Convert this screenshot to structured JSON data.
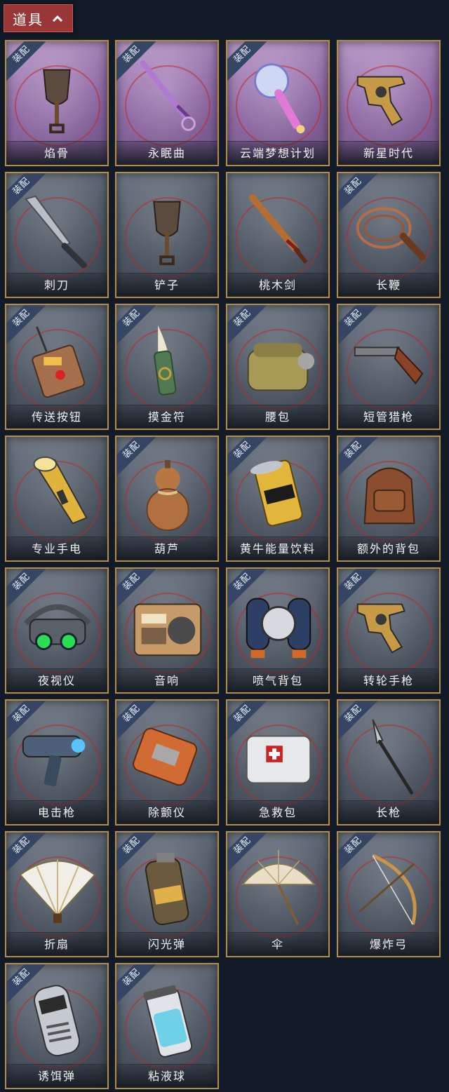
{
  "section": {
    "title": "道具",
    "collapse_icon": "chevron-up-icon"
  },
  "colors": {
    "background": "#121a27",
    "tab": "#9b3636",
    "card_border": "#b18c4a",
    "ribbon": "#354563",
    "ring": "#be2828"
  },
  "equip_label": "装配",
  "items": [
    {
      "name": "焰骨",
      "icon": "shovel-icon",
      "equipped": true,
      "rarity": "purple"
    },
    {
      "name": "永眠曲",
      "icon": "sword-icon",
      "equipped": true,
      "rarity": "purple"
    },
    {
      "name": "云端梦想计划",
      "icon": "mace-icon",
      "equipped": true,
      "rarity": "purple"
    },
    {
      "name": "新星时代",
      "icon": "revolver-icon",
      "equipped": false,
      "rarity": "purple"
    },
    {
      "name": "刺刀",
      "icon": "bayonet-icon",
      "equipped": true,
      "rarity": "gray"
    },
    {
      "name": "铲子",
      "icon": "shovel-icon",
      "equipped": false,
      "rarity": "gray"
    },
    {
      "name": "桃木剑",
      "icon": "wooden-sword-icon",
      "equipped": false,
      "rarity": "gray"
    },
    {
      "name": "长鞭",
      "icon": "whip-icon",
      "equipped": true,
      "rarity": "gray"
    },
    {
      "name": "传送按钮",
      "icon": "remote-icon",
      "equipped": true,
      "rarity": "gray"
    },
    {
      "name": "摸金符",
      "icon": "talisman-icon",
      "equipped": true,
      "rarity": "gray"
    },
    {
      "name": "腰包",
      "icon": "waist-bag-icon",
      "equipped": true,
      "rarity": "gray"
    },
    {
      "name": "短管猎枪",
      "icon": "shotgun-icon",
      "equipped": true,
      "rarity": "gray"
    },
    {
      "name": "专业手电",
      "icon": "flashlight-icon",
      "equipped": false,
      "rarity": "gray"
    },
    {
      "name": "葫芦",
      "icon": "gourd-icon",
      "equipped": true,
      "rarity": "gray"
    },
    {
      "name": "黄牛能量饮料",
      "icon": "can-icon",
      "equipped": true,
      "rarity": "gray"
    },
    {
      "name": "额外的背包",
      "icon": "backpack-icon",
      "equipped": true,
      "rarity": "gray"
    },
    {
      "name": "夜视仪",
      "icon": "goggles-icon",
      "equipped": true,
      "rarity": "gray"
    },
    {
      "name": "音响",
      "icon": "radio-icon",
      "equipped": true,
      "rarity": "gray"
    },
    {
      "name": "喷气背包",
      "icon": "jetpack-icon",
      "equipped": true,
      "rarity": "gray"
    },
    {
      "name": "转轮手枪",
      "icon": "revolver-icon",
      "equipped": true,
      "rarity": "gray"
    },
    {
      "name": "电击枪",
      "icon": "shock-gun-icon",
      "equipped": true,
      "rarity": "gray"
    },
    {
      "name": "除颤仪",
      "icon": "defibrillator-icon",
      "equipped": true,
      "rarity": "gray"
    },
    {
      "name": "急救包",
      "icon": "first-aid-icon",
      "equipped": true,
      "rarity": "gray"
    },
    {
      "name": "长枪",
      "icon": "spear-icon",
      "equipped": true,
      "rarity": "gray"
    },
    {
      "name": "折扇",
      "icon": "fan-icon",
      "equipped": true,
      "rarity": "gray"
    },
    {
      "name": "闪光弹",
      "icon": "grenade-icon",
      "equipped": true,
      "rarity": "gray"
    },
    {
      "name": "伞",
      "icon": "umbrella-icon",
      "equipped": true,
      "rarity": "gray"
    },
    {
      "name": "爆炸弓",
      "icon": "bow-icon",
      "equipped": true,
      "rarity": "gray"
    },
    {
      "name": "诱饵弹",
      "icon": "canister-icon",
      "equipped": true,
      "rarity": "gray"
    },
    {
      "name": "粘液球",
      "icon": "slime-jar-icon",
      "equipped": true,
      "rarity": "gray"
    }
  ]
}
